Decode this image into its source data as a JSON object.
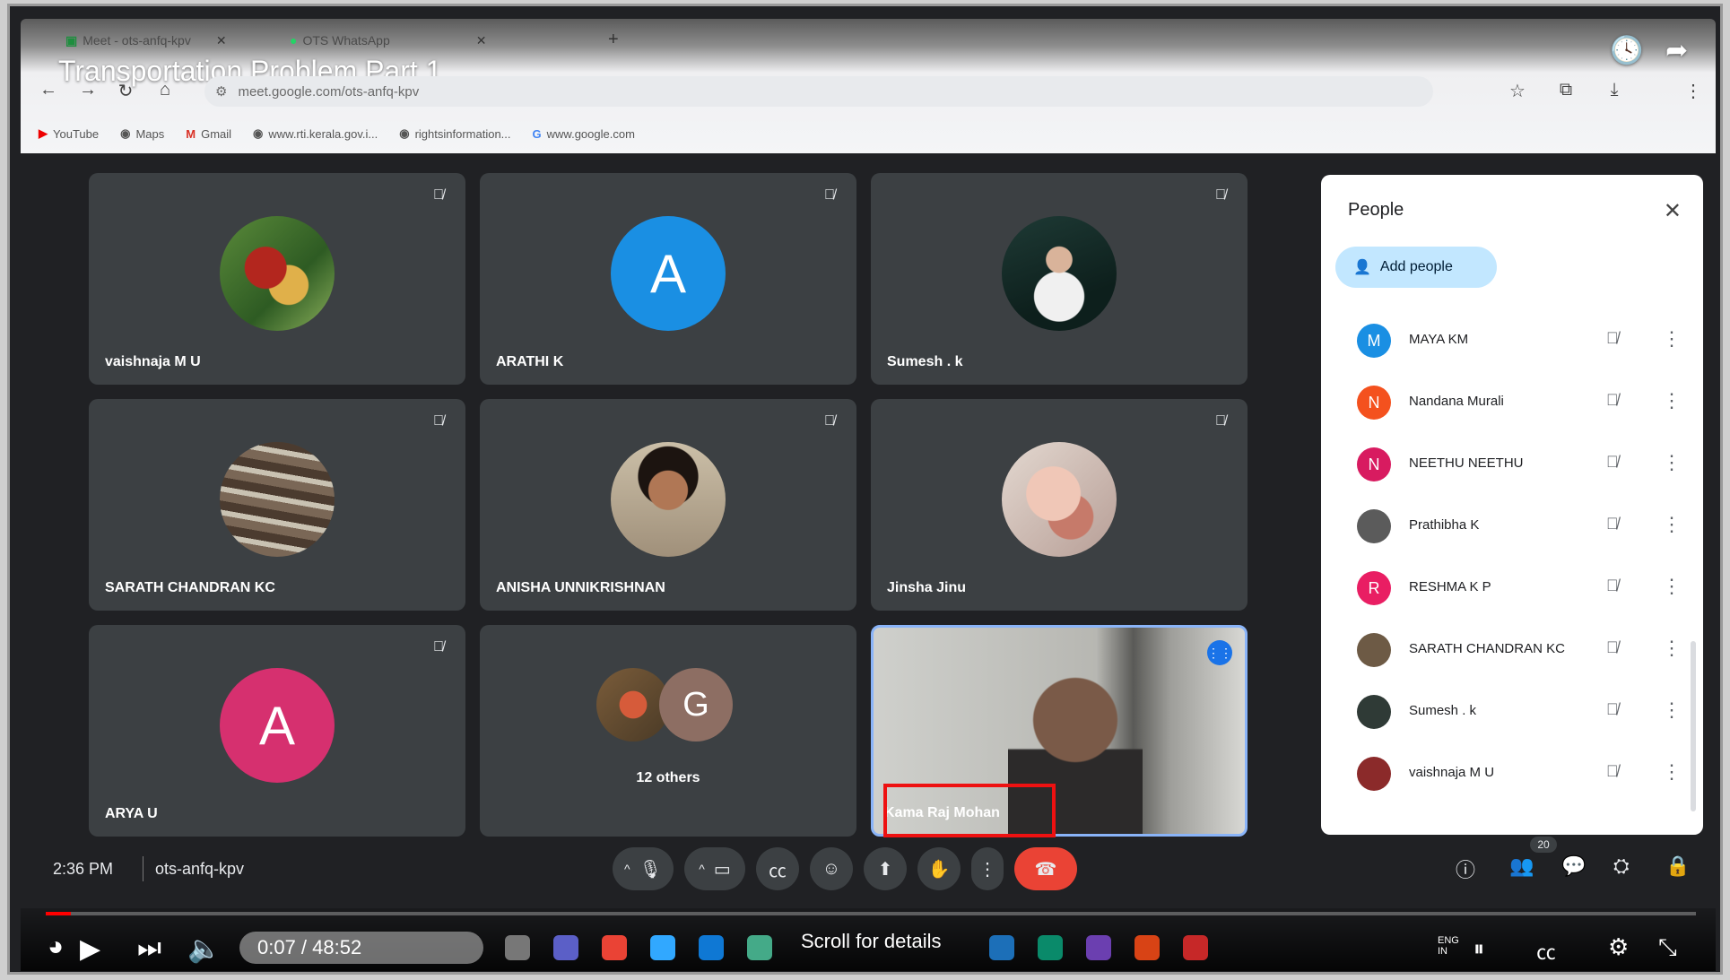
{
  "video": {
    "title": "Transportation Problem Part 1",
    "time": "0:07 / 48:52",
    "progress": 0.0024,
    "scroll_hint": "Scroll for details"
  },
  "browser": {
    "tabs": [
      "Meet - ots-anfq-kpv",
      "OTS WhatsApp"
    ],
    "url": "meet.google.com/ots-anfq-kpv",
    "bookmarks": [
      "YouTube",
      "Maps",
      "Gmail",
      "www.rti.kerala.gov.i...",
      "rightsinformation...",
      "www.google.com"
    ]
  },
  "tiles": [
    {
      "name": "vaishnaja M U"
    },
    {
      "name": "ARATHI K",
      "initial": "A",
      "color": "#1a8fe3"
    },
    {
      "name": "Sumesh . k"
    },
    {
      "name": "SARATH CHANDRAN KC"
    },
    {
      "name": "ANISHA UNNIKRISHNAN"
    },
    {
      "name": "Jinsha Jinu"
    },
    {
      "name": "ARYA U",
      "initial": "A",
      "color": "#d6306f"
    },
    {
      "name": "12 others",
      "initial": "G",
      "color": "#8d6e63"
    },
    {
      "name": "Kama Raj Mohan"
    }
  ],
  "people_panel": {
    "title": "People",
    "add_label": "Add people",
    "participants": [
      {
        "name": "MAYA KM",
        "initial": "M",
        "color": "#1a8fe3"
      },
      {
        "name": "Nandana Murali",
        "initial": "N",
        "color": "#f4511e"
      },
      {
        "name": "NEETHU NEETHU",
        "initial": "N",
        "color": "#d81b60"
      },
      {
        "name": "Prathibha K",
        "initial": "",
        "color": "#5b5b5b"
      },
      {
        "name": "RESHMA K P",
        "initial": "R",
        "color": "#e91e63"
      },
      {
        "name": "SARATH CHANDRAN KC",
        "initial": "",
        "color": "#6d5a45"
      },
      {
        "name": "Sumesh . k",
        "initial": "",
        "color": "#2f3a36"
      },
      {
        "name": "vaishnaja M U",
        "initial": "",
        "color": "#8b2a2a"
      }
    ]
  },
  "meet_bar": {
    "clock": "2:36 PM",
    "code": "ots-anfq-kpv",
    "participant_count": "20"
  },
  "icons": {
    "mic_off": "🎙",
    "more": "⋮",
    "close": "✕",
    "add_person": "👤"
  },
  "taskbar": {
    "lang": "ENG",
    "region": "IN"
  }
}
